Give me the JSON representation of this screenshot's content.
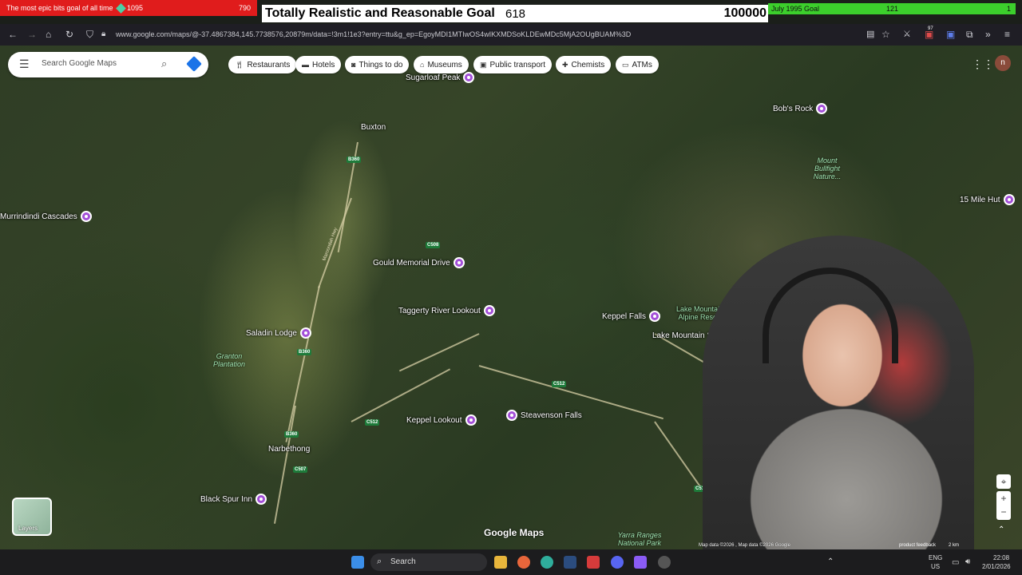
{
  "overlay": {
    "left_goal": {
      "title": "The most epic bits goal of all time",
      "current": "1095",
      "target": "790"
    },
    "mid_goal": {
      "title": "Totally Realistic and Reasonable Goal",
      "current": "618",
      "target": "100000"
    },
    "right_goal": {
      "title": "July 1995 Goal",
      "current": "121",
      "target": "1"
    }
  },
  "browser": {
    "url": "www.google.com/maps/@-37.4867384,145.7738576,20879m/data=!3m1!1e3?entry=ttu&g_ep=EgoyMDI1MTIwOS4wIKXMDSoKLDEwMDc5MjA2OUgBUAM%3D",
    "extensions_badge": "97"
  },
  "maps": {
    "search_placeholder": "Search Google Maps",
    "chips": [
      {
        "icon": "fork-knife-icon",
        "label": "Restaurants"
      },
      {
        "icon": "bed-icon",
        "label": "Hotels"
      },
      {
        "icon": "camera-icon",
        "label": "Things to do"
      },
      {
        "icon": "museum-icon",
        "label": "Museums"
      },
      {
        "icon": "train-icon",
        "label": "Public transport"
      },
      {
        "icon": "pharmacy-icon",
        "label": "Chemists"
      },
      {
        "icon": "atm-icon",
        "label": "ATMs"
      }
    ],
    "avatar_letter": "n",
    "layers_label": "Layers",
    "logo": "Google Maps",
    "attribution": "Map data ©2026 , Map data ©2026 Google",
    "scale": "2 km",
    "feedback": "product feedback",
    "places": {
      "sugarloaf": "Sugarloaf Peak",
      "bobs_rock": "Bob's Rock",
      "murrindindi": "Murrindindi Cascades",
      "fifteen_mile": "15 Mile Hut",
      "gould": "Gould Memorial Drive",
      "taggerty": "Taggerty River Lookout",
      "keppel_falls": "Keppel Falls",
      "lake_mountain_resort": "Lake Mountain Alpine Resort",
      "lake_mountain_summit": "Lake Mountain Summit",
      "saladin": "Saladin Lodge",
      "keppel_lookout": "Keppel Lookout",
      "steavenson": "Steavenson Falls",
      "black_spur": "Black Spur Inn",
      "yarra": "Yarra Ranges National Park"
    },
    "towns": {
      "buxton": "Buxton",
      "narbethong": "Narbethong"
    },
    "natural": {
      "bullfight": "Mount Bullfight Nature...",
      "granton": "Granton Plantation",
      "maroondah": "Maroondah Hwy"
    },
    "roads": [
      "B360",
      "C508",
      "C512",
      "C512",
      "B360",
      "C507",
      "C513",
      "B360"
    ]
  },
  "taskbar": {
    "search": "Search",
    "lang": "ENG",
    "region": "US",
    "time": "22:08",
    "date": "2/01/2026"
  }
}
